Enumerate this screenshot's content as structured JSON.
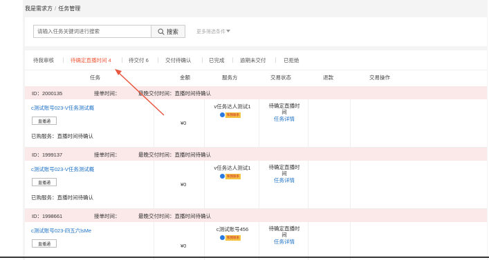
{
  "breadcrumb": {
    "root": "我是需求方",
    "separator": "/",
    "current": "任务管理"
  },
  "search": {
    "placeholder": "请输入任务关键词进行搜索",
    "button_label": "搜索",
    "more_filters": "更多筛选条件"
  },
  "tabs": [
    {
      "label": "待我审核",
      "active": false
    },
    {
      "label": "待确定直播时间 4",
      "active": true
    },
    {
      "label": "待交付 6",
      "active": false
    },
    {
      "label": "交付待确认",
      "active": false
    },
    {
      "label": "已完成",
      "active": false
    },
    {
      "label": "逾期未交付",
      "active": false
    },
    {
      "label": "已拒绝",
      "active": false
    }
  ],
  "columns": [
    "任务",
    "金额",
    "服务方",
    "交易状态",
    "退款",
    "交易操作"
  ],
  "orders": [
    {
      "id": "ID：2000135",
      "accept_time": "接单时间：",
      "deadline": "最晚交付时间：直播时间待确认",
      "task": "c测试账号023-V任务测试概",
      "tag": "直播通",
      "bought": "已购服务：直播时间待确认",
      "amount": "¥0",
      "provider": "v任务达人测试1",
      "contact": "和我联系",
      "status_line1": "待确定直播时",
      "status_line2": "间",
      "detail": "任务详情"
    },
    {
      "id": "ID：1999137",
      "accept_time": "接单时间：",
      "deadline": "最晚交付时间：直播时间待确认",
      "task": "c测试账号023-V任务测试概",
      "tag": "直播通",
      "bought": "已购服务：直播时间待确认",
      "amount": "¥0",
      "provider": "v任务达人测试1",
      "contact": "和我联系",
      "status_line1": "待确定直播时",
      "status_line2": "间",
      "detail": "任务详情"
    },
    {
      "id": "ID：1998661",
      "accept_time": "接单时间：",
      "deadline": "最晚交付时间：直播时间待确认",
      "task": "c测试账号023-四五六lsMe",
      "tag": "直播通",
      "bought": "",
      "amount": "¥0",
      "provider": "c测试账号456",
      "contact": "和我联系",
      "status_line1": "待确定直播时",
      "status_line2": "间",
      "detail": "任务详情"
    }
  ],
  "colors": {
    "accent": "#f05a3c",
    "link": "#1a6fc4",
    "order_head_bg": "#fbe8e8",
    "page_bg": "#f4f4f4"
  }
}
